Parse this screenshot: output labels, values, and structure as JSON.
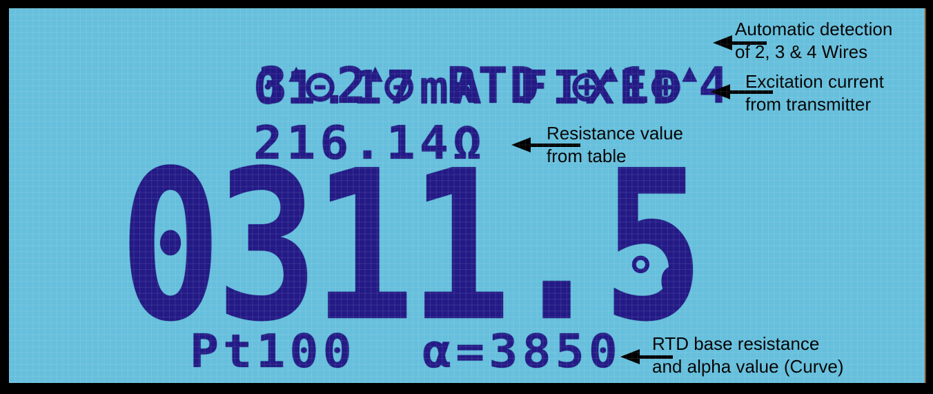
{
  "display": {
    "wire_terminals": "3^⊝2^⊝ RTD ⊕^1⊕^4",
    "terminals": [
      {
        "label": "3",
        "marker": "up-arrow"
      },
      {
        "label": "⊝",
        "marker": "minus-circle"
      },
      {
        "label": "2",
        "marker": "up-arrow"
      },
      {
        "label": "⊝",
        "marker": "minus-circle"
      },
      {
        "label": "RTD",
        "marker": ""
      },
      {
        "label": "⊕",
        "marker": "plus-circle"
      },
      {
        "label": "1",
        "marker": "up-arrow"
      },
      {
        "label": "⊕",
        "marker": "plus-circle"
      },
      {
        "label": "4",
        "marker": "up-arrow"
      }
    ],
    "excitation_current": "01.17mA FIXED",
    "resistance": "216.14Ω",
    "temperature": "0311.5",
    "temperature_unit": "°c",
    "sensor_type": "Pt100",
    "alpha": "α=3850"
  },
  "annotations": [
    {
      "line1": "Automatic detection",
      "line2": "of 2, 3 & 4 Wires"
    },
    {
      "line1": "Excitation current",
      "line2": "from transmitter"
    },
    {
      "line1": "Resistance value",
      "line2": "from table"
    },
    {
      "line1": "RTD base resistance",
      "line2": "and alpha value (Curve)"
    }
  ],
  "colors": {
    "lcd_background": "#66bfdc",
    "lcd_pixel": "#231a86",
    "frame": "#000000",
    "annotation_text": "#000000"
  }
}
